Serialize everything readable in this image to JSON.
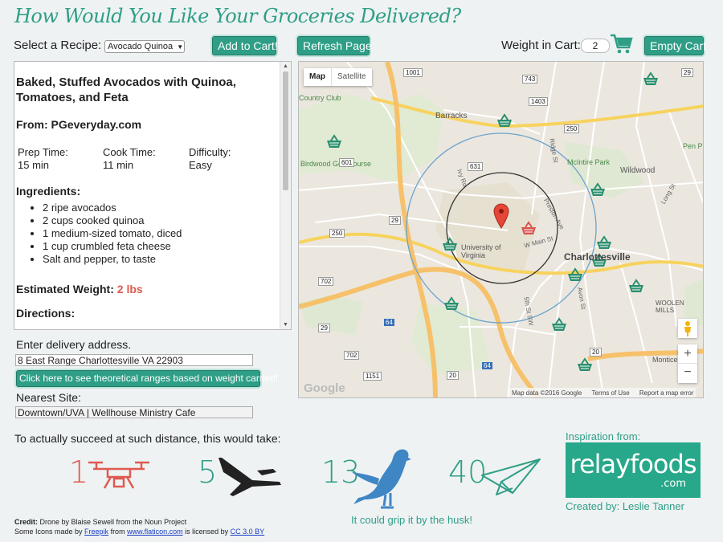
{
  "header": {
    "title": "How Would You Like Your Groceries Delivered?"
  },
  "toolbar": {
    "select_label": "Select a Recipe:",
    "recipe_selected": "Avocado Quinoa",
    "add_button": "Add to Cart!",
    "refresh_button": "Refresh Page",
    "weight_label": "Weight in Cart:",
    "weight_value": "2",
    "empty_button": "Empty Cart"
  },
  "recipe": {
    "title": "Baked, Stuffed Avocados with Quinoa, Tomatoes, and Feta",
    "from": "From: PGeveryday.com",
    "prep_label": "Prep Time:",
    "prep_value": "15 min",
    "cook_label": "Cook Time:",
    "cook_value": "11 min",
    "diff_label": "Difficulty:",
    "diff_value": "Easy",
    "ingredients_label": "Ingredients:",
    "ingredients": [
      "2 ripe avocados",
      "2 cups cooked quinoa",
      "1 medium-sized tomato, diced",
      "1 cup crumbled feta cheese",
      "Salt and pepper, to taste"
    ],
    "weight_label": "Estimated Weight:",
    "weight_value": "2 lbs",
    "directions_label": "Directions:"
  },
  "delivery": {
    "address_label": "Enter delivery address.",
    "address_value": "8 East Range Charlottesville VA 22903",
    "range_button": "Click here to see theoretical ranges based on weight carried!",
    "nearest_label": "Nearest Site:",
    "nearest_value": "Downtown/UVA | Wellhouse Ministry Cafe"
  },
  "map": {
    "map_tab": "Map",
    "satellite_tab": "Satellite",
    "zoom_in": "+",
    "zoom_out": "−",
    "attribution": "Map data ©2016 Google",
    "terms": "Terms of Use",
    "report": "Report a map error",
    "google": "Google",
    "labels": [
      "Barracks",
      "Country Club",
      "Birdwood Golf Course",
      "McIntire Park",
      "Wildwood",
      "University of Virginia",
      "Charlottesville",
      "W Main St",
      "Preston Ave",
      "Pen P",
      "Monticello",
      "WOOLEN MILLS",
      "5th St SW",
      "Ivy Rd",
      "Avon St",
      "Ridge St",
      "Long St"
    ],
    "routes": [
      "1001",
      "743",
      "29",
      "250",
      "631",
      "29",
      "601",
      "250",
      "702",
      "29",
      "64",
      "64",
      "1403",
      "702",
      "20",
      "20",
      "1151"
    ]
  },
  "transport": {
    "intro": "To actually succeed at such distance, this would take:",
    "items": [
      {
        "count": "1",
        "icon": "drone-icon"
      },
      {
        "count": "5",
        "icon": "military-drone-icon"
      },
      {
        "count": "13",
        "icon": "pigeon-icon"
      },
      {
        "count": "40",
        "icon": "paper-plane-icon"
      }
    ],
    "pigeon_caption": "It could grip it by the husk!"
  },
  "inspiration": {
    "label": "Inspiration from:",
    "logo_text": "relayfoods",
    "logo_sub": ".com",
    "creator": "Created by: Leslie Tanner"
  },
  "credits": {
    "credit_bold": "Credit:",
    "credit_text": " Drone by Blaise Sewell from the Noun Project",
    "line2_a": "Some Icons made by ",
    "freepik": "Freepik",
    "line2_b": " from ",
    "flaticon": "www.flaticon.com",
    "line2_c": " is licensed by ",
    "cc": "CC 3.0 BY"
  },
  "colors": {
    "accent": "#2f9e86",
    "drone_red": "#e05a50",
    "weight_red": "#e05a50",
    "pigeon_blue": "#3f86c4",
    "link": "#1a3cc4"
  }
}
